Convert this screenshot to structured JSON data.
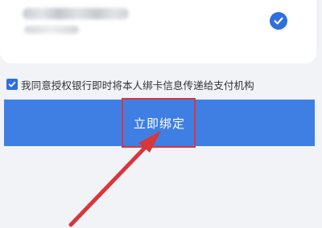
{
  "card": {
    "masked_line_icon": "blurred-account-text",
    "selected_icon": "check-circle-icon"
  },
  "agreement": {
    "text": "我同意授权银行即时将本人绑卡信息传递给支付机构",
    "checked_icon": "checkbox-checked-icon"
  },
  "actions": {
    "bind_label": "立即绑定"
  },
  "annotation": {
    "highlight": "red-highlight-box",
    "arrow": "red-arrow-icon"
  },
  "colors": {
    "accent": "#3f7fe3",
    "check": "#2f6fde",
    "annotation": "#d9363b",
    "background": "#f1f3f7"
  }
}
